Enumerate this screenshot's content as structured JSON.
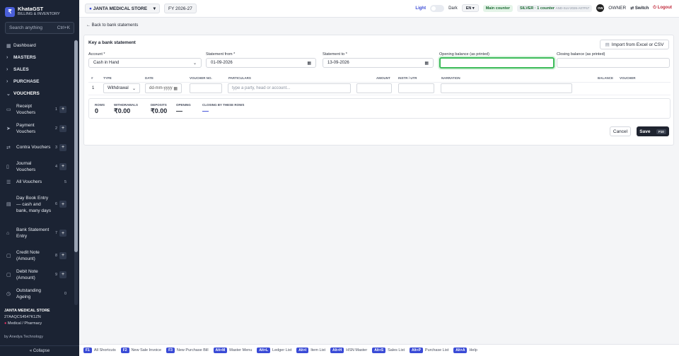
{
  "brand": {
    "name": "KhataGST",
    "subtitle": "BILLING & INVENTORY",
    "logo": "₹"
  },
  "search": {
    "placeholder": "Search anything",
    "shortcut": "Ctrl+K"
  },
  "nav": [
    {
      "label": "Dashboard",
      "icon": "grid-icon"
    },
    {
      "label": "MASTERS",
      "icon": "chevron-right-icon"
    },
    {
      "label": "SALES",
      "icon": "chevron-right-icon"
    },
    {
      "label": "PURCHASE",
      "icon": "chevron-right-icon"
    },
    {
      "label": "VOUCHERS",
      "icon": "chevron-down-icon"
    }
  ],
  "vouchers": [
    {
      "label": "Receipt Vouchers",
      "num": "1",
      "plus": "+"
    },
    {
      "label": "Payment Vouchers",
      "num": "2",
      "plus": "+"
    },
    {
      "label": "Contra Vouchers",
      "num": "3",
      "plus": "+"
    },
    {
      "label": "Journal Vouchers",
      "num": "4",
      "plus": "+"
    },
    {
      "label": "All Vouchers",
      "num": "5",
      "plus": ""
    },
    {
      "label": "Day Book Entry — cash and bank, many days",
      "num": "6",
      "plus": "+"
    },
    {
      "label": "Bank Statement Entry",
      "num": "7",
      "plus": "+"
    },
    {
      "label": "Credit Note (Amount)",
      "num": "8",
      "plus": "+"
    },
    {
      "label": "Debit Note (Amount)",
      "num": "9",
      "plus": "+"
    },
    {
      "label": "Outstanding Ageing",
      "num": "0",
      "plus": ""
    }
  ],
  "store": {
    "name": "JANTA MEDICAL STORE",
    "gstin": "27AAQCS4547K1ZN",
    "type": "Medical / Pharmacy"
  },
  "by": "by Anedya Technology",
  "collapse": "« Collapse",
  "topbar": {
    "store": "JANTA MEDICAL STORE",
    "fy": "FY 2026-27",
    "light": "Light",
    "dark": "Dark",
    "lang": "EN",
    "counter": "Main counter",
    "plan": "SILVER · 1 counter",
    "plan_code": "AND-SLV-2026-A07F67",
    "avatar": "OW",
    "owner": "OWNER",
    "switch": "Switch",
    "logout": "Logout"
  },
  "back": "← Back to bank statements",
  "form": {
    "title": "Key a bank statement",
    "import": "Import from Excel or CSV",
    "account_label": "Account *",
    "account_value": "Cash in Hand",
    "from_label": "Statement from *",
    "from_value": "01-09-2026",
    "to_label": "Statement to *",
    "to_value": "13-09-2026",
    "opening_label": "Opening balance (as printed)",
    "opening_value": "",
    "closing_label": "Closing balance (as printed)",
    "closing_value": ""
  },
  "table": {
    "headers": [
      "#",
      "TYPE",
      "DATE",
      "VOUCHER NO.",
      "PARTICULARS",
      "AMOUNT",
      "INSTR / UTR",
      "NARRATION",
      "BALANCE",
      "VOUCHER"
    ],
    "row": {
      "num": "1",
      "type": "Withdrawal",
      "date": "dd-mm-yyyy",
      "particulars_placeholder": "type a party, head or account..."
    }
  },
  "summary": [
    {
      "k": "ROWS",
      "v": "0"
    },
    {
      "k": "WITHDRAWALS",
      "v": "₹0.00"
    },
    {
      "k": "DEPOSITS",
      "v": "₹0.00"
    },
    {
      "k": "OPENING",
      "v": "—"
    },
    {
      "k": "CLOSING BY THESE ROWS",
      "v": "—"
    }
  ],
  "actions": {
    "cancel": "Cancel",
    "save": "Save",
    "save_key": "F10"
  },
  "footer": [
    {
      "key": "F1",
      "label": "All Shortcuts"
    },
    {
      "key": "F2",
      "label": "New Sale Invoice"
    },
    {
      "key": "F3",
      "label": "New Purchase Bill"
    },
    {
      "key": "Alt+M",
      "label": "Master Menu"
    },
    {
      "key": "Alt+L",
      "label": "Ledger List"
    },
    {
      "key": "Alt+I",
      "label": "Item List"
    },
    {
      "key": "Alt+H",
      "label": "HSN Master"
    },
    {
      "key": "Alt+S",
      "label": "Sales List"
    },
    {
      "key": "Alt+P",
      "label": "Purchase List"
    },
    {
      "key": "Alt+A",
      "label": "Help"
    }
  ],
  "colors": {
    "sidebar": "#1b2333",
    "accent": "#3a4bd6",
    "focus": "#3dbb5a"
  }
}
